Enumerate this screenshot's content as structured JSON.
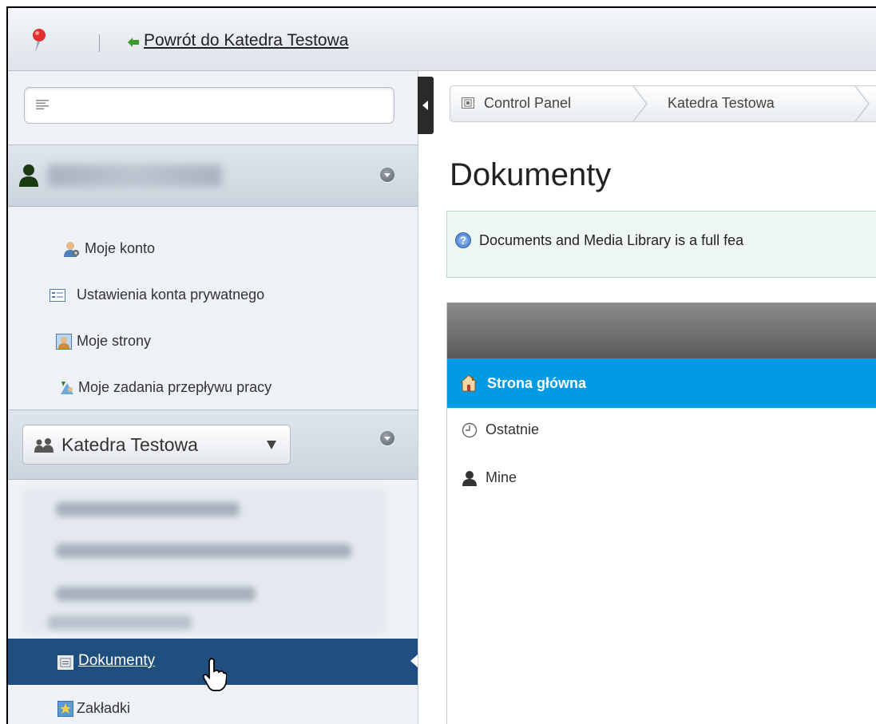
{
  "topbar": {
    "back_link": "Powrót do Katedra Testowa"
  },
  "sidebar": {
    "user_menu": [
      {
        "label": "Moje konto",
        "icon": "user-gear-icon"
      },
      {
        "label": "Ustawienia konta prywatnego",
        "icon": "form-icon"
      },
      {
        "label": "Moje strony",
        "icon": "profile-picture-icon"
      },
      {
        "label": "Moje zadania przepływu pracy",
        "icon": "workflow-icon"
      }
    ],
    "site_selector": "Katedra Testowa",
    "active_item": "Dokumenty",
    "bottom_item": "Zakładki"
  },
  "content": {
    "breadcrumb": [
      "Control Panel",
      "Katedra Testowa"
    ],
    "title": "Dokumenty",
    "info_text": "Documents and Media Library is a full fea",
    "nav": {
      "home": "Strona główna",
      "recent": "Ostatnie",
      "mine": "Mine"
    }
  },
  "colors": {
    "active_sidebar": "#1f4f7f",
    "nav_selected": "#009ae5",
    "info_background": "#eef7f2"
  }
}
